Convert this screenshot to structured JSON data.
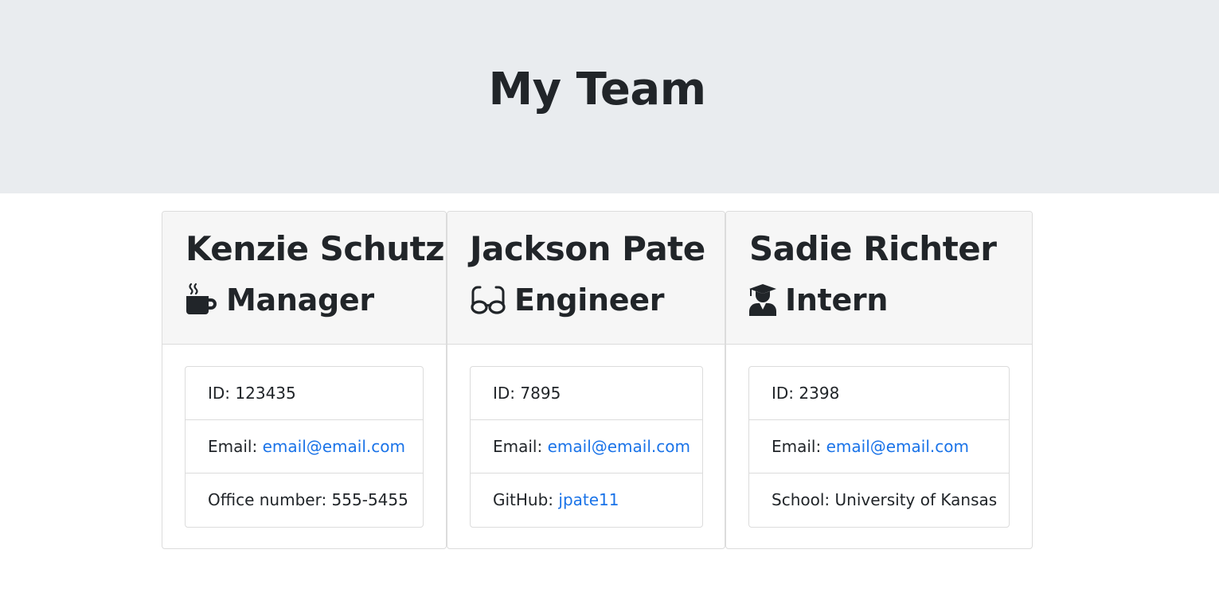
{
  "header": {
    "title": "My Team"
  },
  "cards": [
    {
      "name": "Kenzie Schutz",
      "role": "Manager",
      "icon": "mug-hot-icon",
      "id_label": "ID: ",
      "id_value": "123435",
      "email_label": "Email: ",
      "email_value": "email@email.com",
      "extra_label": "Office number: ",
      "extra_value": "555-5455"
    },
    {
      "name": "Jackson Pate",
      "role": "Engineer",
      "icon": "glasses-icon",
      "id_label": "ID: ",
      "id_value": "7895",
      "email_label": "Email: ",
      "email_value": "email@email.com",
      "extra_label": "GitHub: ",
      "extra_value": "jpate11"
    },
    {
      "name": "Sadie Richter",
      "role": "Intern",
      "icon": "graduate-icon",
      "id_label": "ID: ",
      "id_value": "2398",
      "email_label": "Email: ",
      "email_value": "email@email.com",
      "extra_label": "School: ",
      "extra_value": "University of Kansas"
    }
  ],
  "colors": {
    "link": "#1a73e8",
    "jumbotron": "#e9ecef",
    "header_bg": "#f6f6f6",
    "text": "#212529"
  }
}
